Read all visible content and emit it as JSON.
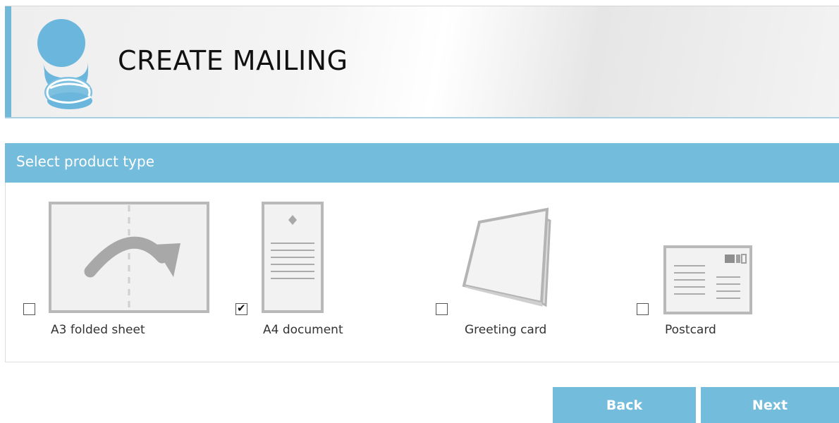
{
  "header": {
    "title": "CREATE MAILING",
    "accent_color": "#72b9d9",
    "logo_icon": "blue-stamp-icon"
  },
  "product_panel": {
    "title": "Select product type",
    "bar_color": "#74bcdc",
    "options": [
      {
        "id": "a3-folded-sheet",
        "label": "A3 folded sheet",
        "checked": false,
        "icon": "folded-sheet-arrow-icon"
      },
      {
        "id": "a4-document",
        "label": "A4 document",
        "checked": true,
        "icon": "document-icon"
      },
      {
        "id": "greeting-card",
        "label": "Greeting card",
        "checked": false,
        "icon": "greeting-card-icon"
      },
      {
        "id": "postcard",
        "label": "Postcard",
        "checked": false,
        "icon": "postcard-icon"
      }
    ]
  },
  "buttons": {
    "back_label": "Back",
    "next_label": "Next",
    "color": "#74bcdc"
  }
}
